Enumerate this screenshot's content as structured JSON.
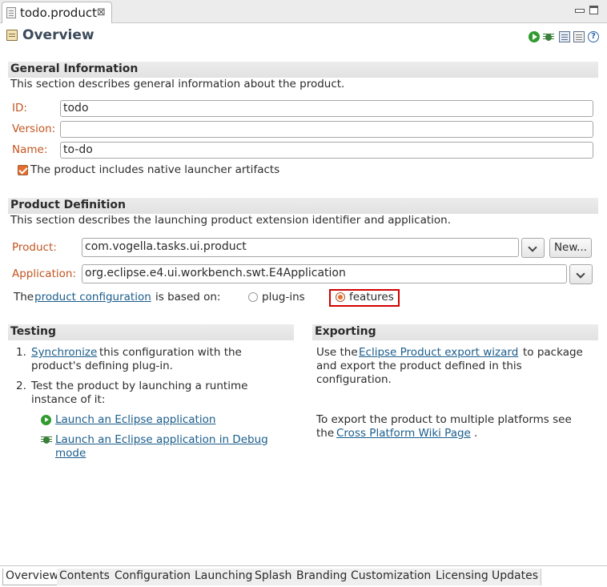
{
  "editor_tab": {
    "title": "todo.product",
    "close": "⊠"
  },
  "header": {
    "title": "Overview",
    "help": "?"
  },
  "general": {
    "title": "General Information",
    "description": "This section describes general information about the product.",
    "id_label": "ID:",
    "id_value": "todo",
    "version_label": "Version:",
    "version_value": "",
    "name_label": "Name:",
    "name_value": "to-do",
    "launcher_checkbox_label": "The product includes native launcher artifacts",
    "launcher_checked": true
  },
  "definition": {
    "title": "Product Definition",
    "description": "This section describes the launching product extension identifier and application.",
    "product_label": "Product:",
    "product_value": "com.vogella.tasks.ui.product",
    "new_button": "New...",
    "application_label": "Application:",
    "application_value": "org.eclipse.e4.ui.workbench.swt.E4Application",
    "config_prefix": "The",
    "config_link": "product configuration",
    "config_suffix": "is based on:",
    "radio_plugins": "plug-ins",
    "radio_features": "features",
    "selected": "features"
  },
  "testing": {
    "title": "Testing",
    "item1_num": "1.",
    "item1_link": "Synchronize",
    "item1_text_a": "this configuration with the",
    "item1_text_b": "product's defining plug-in.",
    "item2_num": "2.",
    "item2_text_a": "Test the product by launching a runtime",
    "item2_text_b": "instance of it:",
    "launch_link": "Launch an Eclipse application",
    "debug_link_a": "Launch an Eclipse application in Debug",
    "debug_link_b": "mode"
  },
  "exporting": {
    "title": "Exporting",
    "p1_prefix": "Use the",
    "p1_link": "Eclipse Product export wizard",
    "p1_suffix": "to package",
    "p1_line2": "and export the product defined in this",
    "p1_line3": "configuration.",
    "p2_line1": "To export the product to multiple platforms see",
    "p2_prefix": "the",
    "p2_link": "Cross Platform Wiki Page",
    "p2_suffix": "."
  },
  "bottom_tabs": [
    "Overview",
    "Contents",
    "Configuration",
    "Launching",
    "Splash",
    "Branding",
    "Customization",
    "Licensing",
    "Updates"
  ],
  "colors": {
    "label": "#c2541f",
    "link": "#1a5d8c",
    "highlight": "#d20000"
  }
}
